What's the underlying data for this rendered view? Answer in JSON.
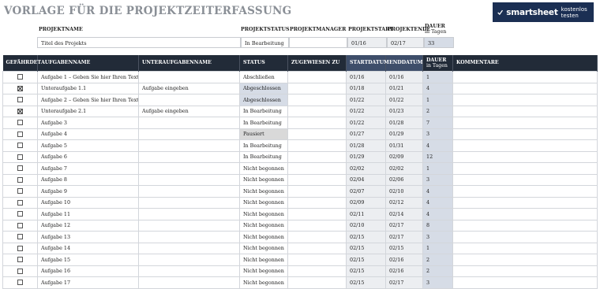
{
  "title": "VORLAGE FÜR DIE PROJEKTZEITERFASSUNG",
  "brand": {
    "name": "smartsheet",
    "cta": "kostenlos testen",
    "color": "#1b2f53"
  },
  "project": {
    "labels": {
      "name": "PROJEKTNAME",
      "status": "PROJEKTSTATUS",
      "manager": "PROJEKTMANAGER",
      "start": "PROJEKTSTART",
      "end": "PROJEKTENDE",
      "duration": "DAUER",
      "duration_unit": "in Tagen"
    },
    "values": {
      "name": "Titel des Projekts",
      "status": "In Bearbeitung",
      "manager": "",
      "start": "01/16",
      "end": "02/17",
      "duration": "33"
    }
  },
  "table": {
    "headers": {
      "at_risk": "GEFÄHRDET",
      "task": "AUFGABENNAME",
      "subtask": "UNTERAUFGABENNAME",
      "status": "STATUS",
      "assigned": "ZUGEWIESEN ZU",
      "start": "STARTDATUM",
      "end": "ENDDATUM",
      "duration": "DAUER",
      "duration_unit": "in Tagen",
      "comments": "KOMMENTARE"
    },
    "rows": [
      {
        "checked": false,
        "task": "Aufgabe 1 – Geben Sie hier Ihren Text ein",
        "subtask": "",
        "status": "Abschließen",
        "assigned": "",
        "start": "01/16",
        "end": "01/16",
        "days": "1",
        "comment": ""
      },
      {
        "checked": true,
        "task": "Unteraufgabe 1.1",
        "subtask": "Aufgabe eingeben",
        "status": "Abgeschlossen",
        "assigned": "",
        "start": "01/18",
        "end": "01/21",
        "days": "4",
        "comment": ""
      },
      {
        "checked": false,
        "task": "Aufgabe 2 – Geben Sie hier Ihren Text ein",
        "subtask": "",
        "status": "Abgeschlossen",
        "assigned": "",
        "start": "01/22",
        "end": "01/22",
        "days": "1",
        "comment": ""
      },
      {
        "checked": true,
        "task": "Unteraufgabe 2.1",
        "subtask": "Aufgabe eingeben",
        "status": "In Bearbeitung",
        "assigned": "",
        "start": "01/22",
        "end": "01/23",
        "days": "2",
        "comment": ""
      },
      {
        "checked": false,
        "task": "Aufgabe 3",
        "subtask": "",
        "status": "In Bearbeitung",
        "assigned": "",
        "start": "01/22",
        "end": "01/28",
        "days": "7",
        "comment": ""
      },
      {
        "checked": false,
        "task": "Aufgabe 4",
        "subtask": "",
        "status": "Pausiert",
        "assigned": "",
        "start": "01/27",
        "end": "01/29",
        "days": "3",
        "comment": ""
      },
      {
        "checked": false,
        "task": "Aufgabe 5",
        "subtask": "",
        "status": "In Bearbeitung",
        "assigned": "",
        "start": "01/28",
        "end": "01/31",
        "days": "4",
        "comment": ""
      },
      {
        "checked": false,
        "task": "Aufgabe 6",
        "subtask": "",
        "status": "In Bearbeitung",
        "assigned": "",
        "start": "01/29",
        "end": "02/09",
        "days": "12",
        "comment": ""
      },
      {
        "checked": false,
        "task": "Aufgabe 7",
        "subtask": "",
        "status": "Nicht begonnen",
        "assigned": "",
        "start": "02/02",
        "end": "02/02",
        "days": "1",
        "comment": ""
      },
      {
        "checked": false,
        "task": "Aufgabe 8",
        "subtask": "",
        "status": "Nicht begonnen",
        "assigned": "",
        "start": "02/04",
        "end": "02/06",
        "days": "3",
        "comment": ""
      },
      {
        "checked": false,
        "task": "Aufgabe 9",
        "subtask": "",
        "status": "Nicht begonnen",
        "assigned": "",
        "start": "02/07",
        "end": "02/10",
        "days": "4",
        "comment": ""
      },
      {
        "checked": false,
        "task": "Aufgabe 10",
        "subtask": "",
        "status": "Nicht begonnen",
        "assigned": "",
        "start": "02/09",
        "end": "02/12",
        "days": "4",
        "comment": ""
      },
      {
        "checked": false,
        "task": "Aufgabe 11",
        "subtask": "",
        "status": "Nicht begonnen",
        "assigned": "",
        "start": "02/11",
        "end": "02/14",
        "days": "4",
        "comment": ""
      },
      {
        "checked": false,
        "task": "Aufgabe 12",
        "subtask": "",
        "status": "Nicht begonnen",
        "assigned": "",
        "start": "02/10",
        "end": "02/17",
        "days": "8",
        "comment": ""
      },
      {
        "checked": false,
        "task": "Aufgabe 13",
        "subtask": "",
        "status": "Nicht begonnen",
        "assigned": "",
        "start": "02/15",
        "end": "02/17",
        "days": "3",
        "comment": ""
      },
      {
        "checked": false,
        "task": "Aufgabe 14",
        "subtask": "",
        "status": "Nicht begonnen",
        "assigned": "",
        "start": "02/15",
        "end": "02/15",
        "days": "1",
        "comment": ""
      },
      {
        "checked": false,
        "task": "Aufgabe 15",
        "subtask": "",
        "status": "Nicht begonnen",
        "assigned": "",
        "start": "02/15",
        "end": "02/16",
        "days": "2",
        "comment": ""
      },
      {
        "checked": false,
        "task": "Aufgabe 16",
        "subtask": "",
        "status": "Nicht begonnen",
        "assigned": "",
        "start": "02/15",
        "end": "02/16",
        "days": "2",
        "comment": ""
      },
      {
        "checked": false,
        "task": "Aufgabe 17",
        "subtask": "",
        "status": "Nicht begonnen",
        "assigned": "",
        "start": "02/15",
        "end": "02/17",
        "days": "3",
        "comment": ""
      }
    ]
  }
}
